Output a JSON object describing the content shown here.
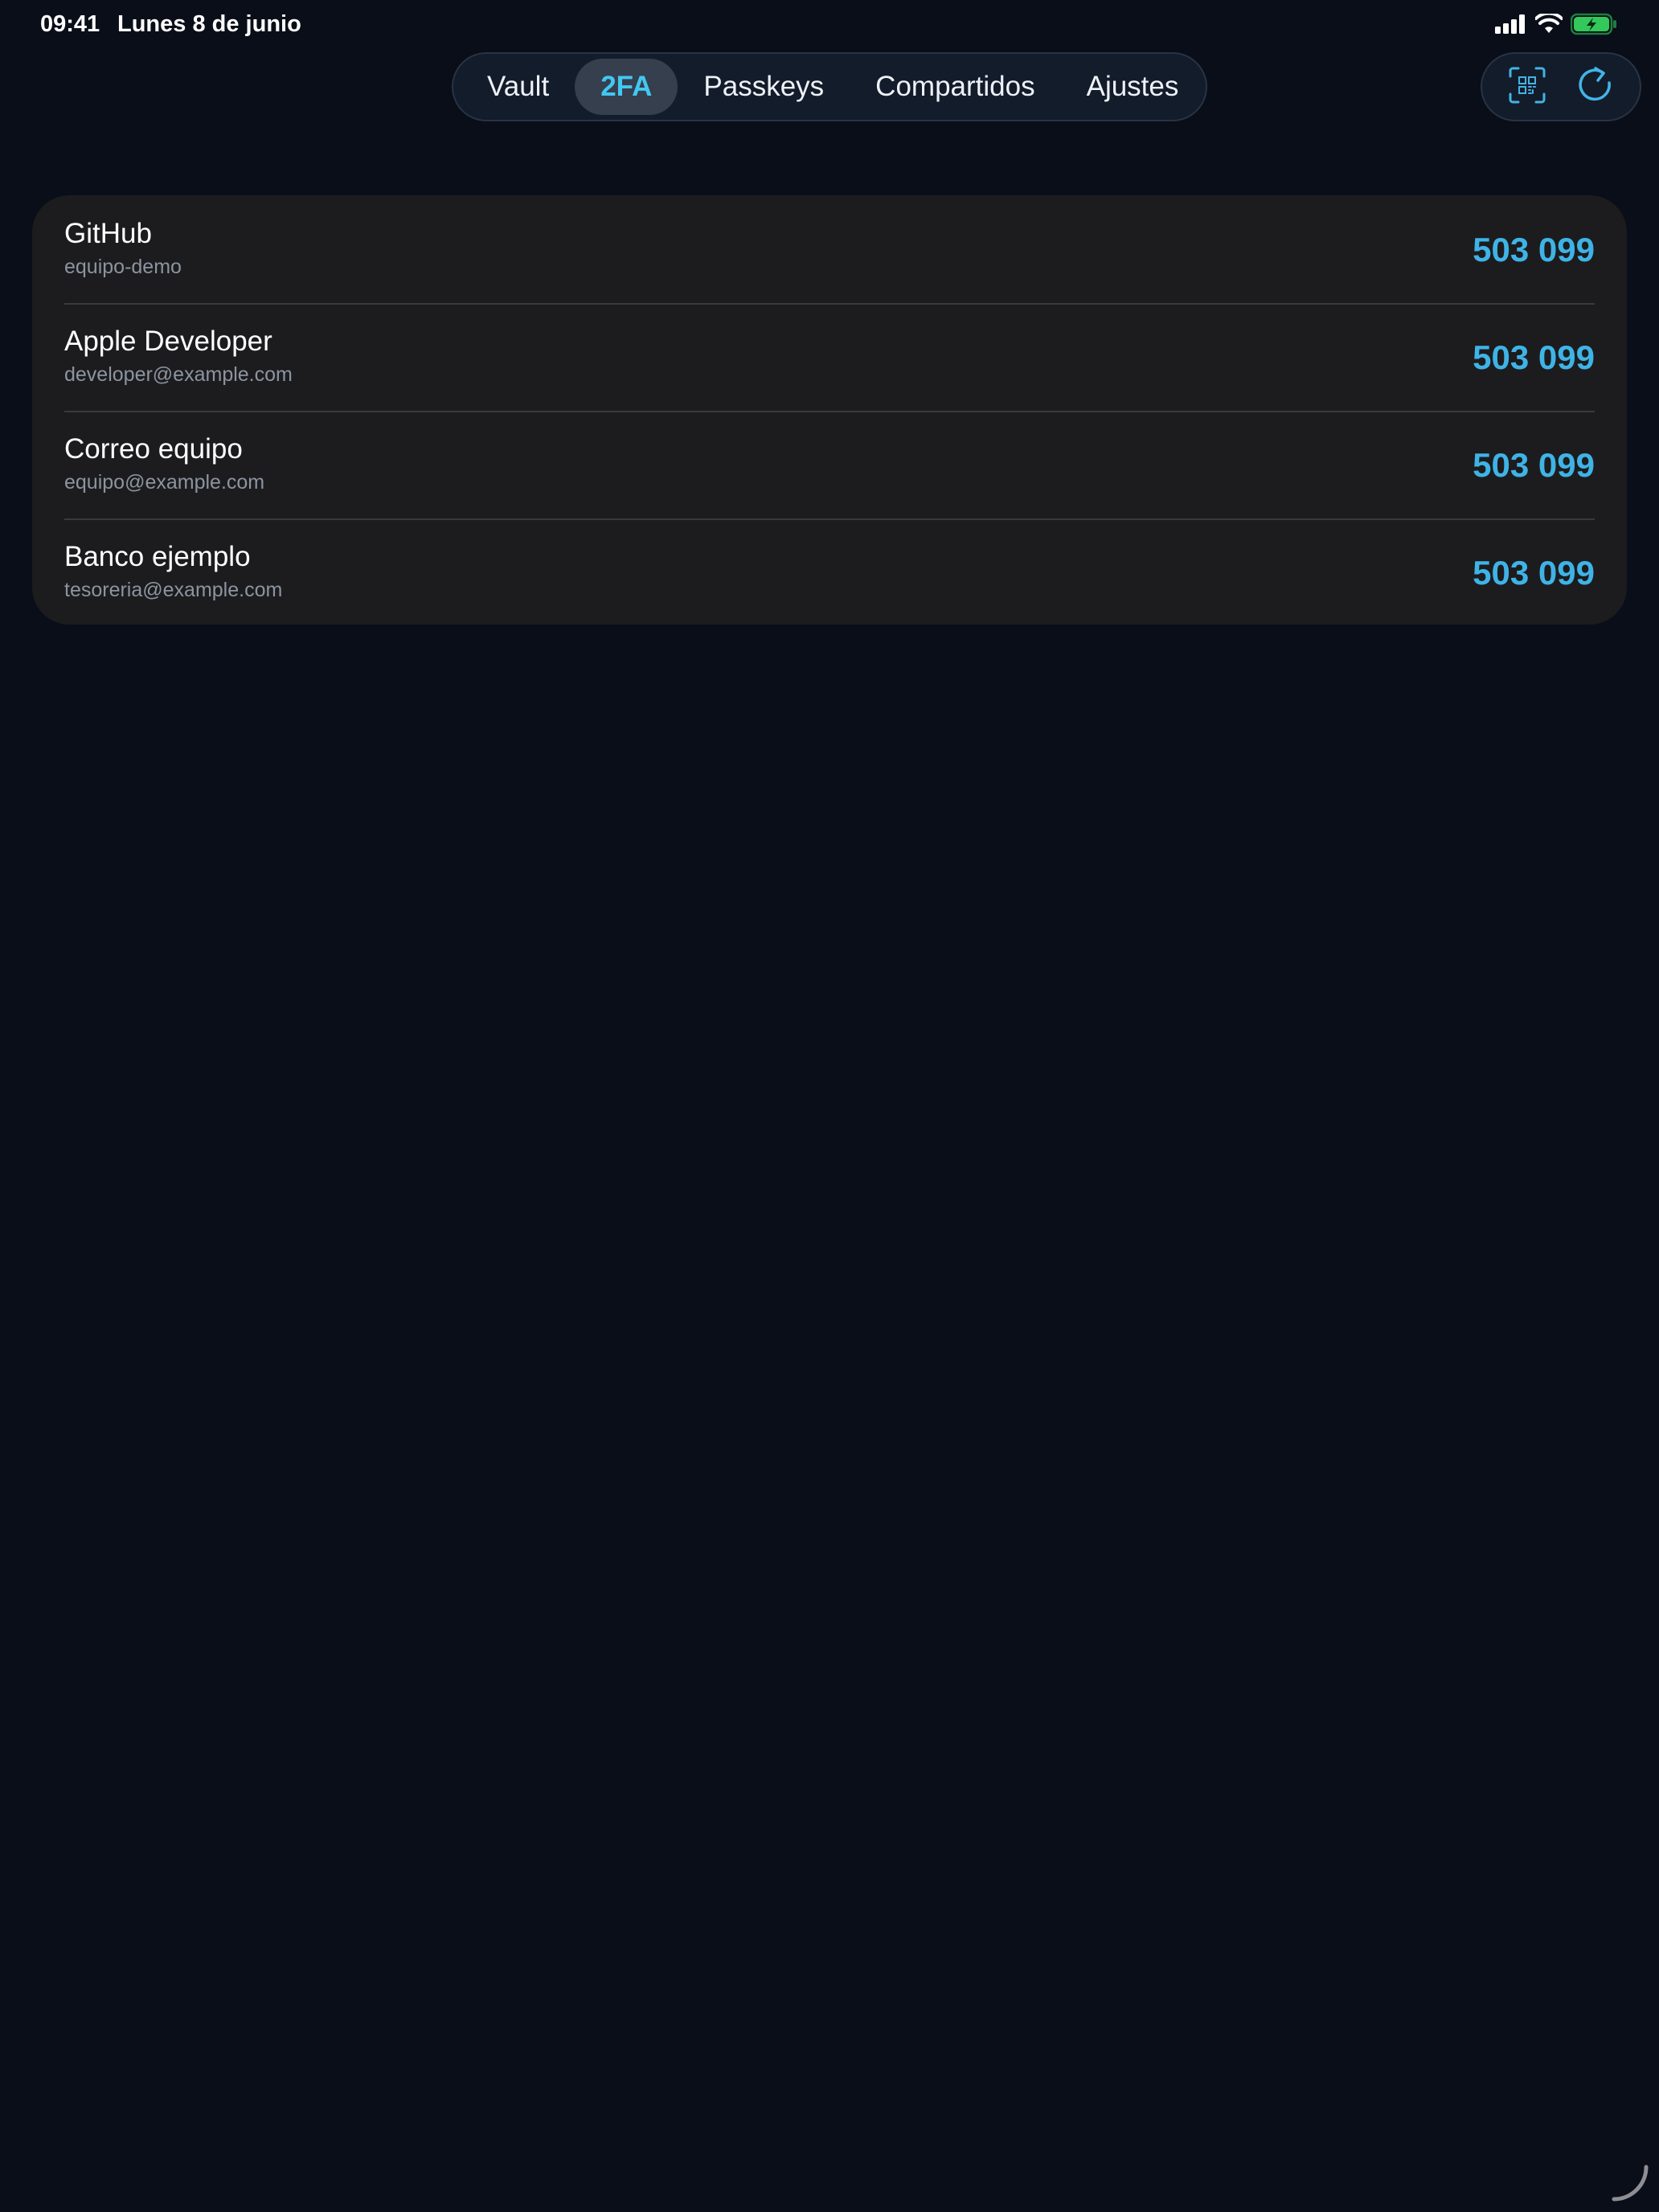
{
  "status_bar": {
    "time": "09:41",
    "date": "Lunes 8 de junio",
    "battery_color": "#34c759"
  },
  "tabs": [
    {
      "label": "Vault",
      "active": false
    },
    {
      "label": "2FA",
      "active": true
    },
    {
      "label": "Passkeys",
      "active": false
    },
    {
      "label": "Compartidos",
      "active": false
    },
    {
      "label": "Ajustes",
      "active": false
    }
  ],
  "actions": {
    "scan": "qr-scan-icon",
    "refresh": "refresh-icon"
  },
  "accent_color": "#42c8f0",
  "entries": [
    {
      "name": "GitHub",
      "account": "equipo-demo",
      "code": "503 099"
    },
    {
      "name": "Apple Developer",
      "account": "developer@example.com",
      "code": "503 099"
    },
    {
      "name": "Correo equipo",
      "account": "equipo@example.com",
      "code": "503 099"
    },
    {
      "name": "Banco ejemplo",
      "account": "tesoreria@example.com",
      "code": "503 099"
    }
  ]
}
